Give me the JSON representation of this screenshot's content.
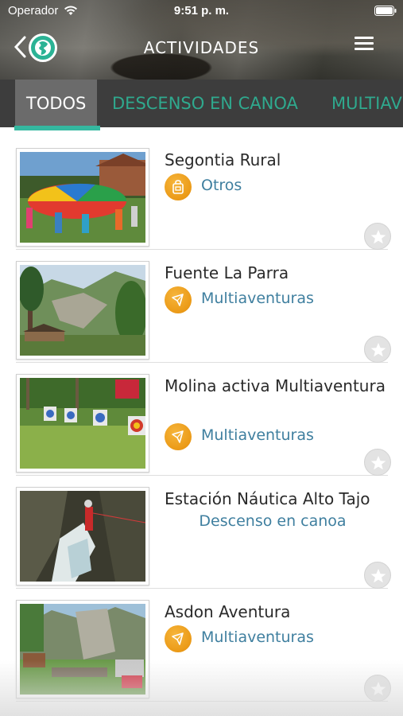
{
  "status_bar": {
    "carrier": "Operador",
    "time": "9:51 p. m.",
    "icons": [
      "wifi-icon",
      "battery-icon"
    ]
  },
  "nav": {
    "title": "ACTIVIDADES",
    "icons": [
      "chevron-left-icon",
      "globe-icon",
      "hamburger-menu-icon"
    ]
  },
  "tabs": [
    {
      "label": "TODOS",
      "active": true
    },
    {
      "label": "DESCENSO EN CANOA",
      "active": false
    },
    {
      "label": "MULTIAV",
      "active": false
    }
  ],
  "colors": {
    "accent": "#35b8a0",
    "tab_text": "#2fa98e",
    "category_text": "#3f7f9f",
    "category_badge": "#eb9a17"
  },
  "items": [
    {
      "title": "Segontia Rural",
      "category": "Otros",
      "category_icon": "bag-icon"
    },
    {
      "title": "Fuente La Parra",
      "category": "Multiaventuras",
      "category_icon": "compass-icon"
    },
    {
      "title": "Molina activa Multiaventura",
      "category": "Multiaventuras",
      "category_icon": "compass-icon"
    },
    {
      "title": "Estación Náutica Alto Tajo",
      "category": "Descenso en canoa",
      "category_icon": ""
    },
    {
      "title": "Asdon Aventura",
      "category": "Multiaventuras",
      "category_icon": "compass-icon"
    }
  ]
}
